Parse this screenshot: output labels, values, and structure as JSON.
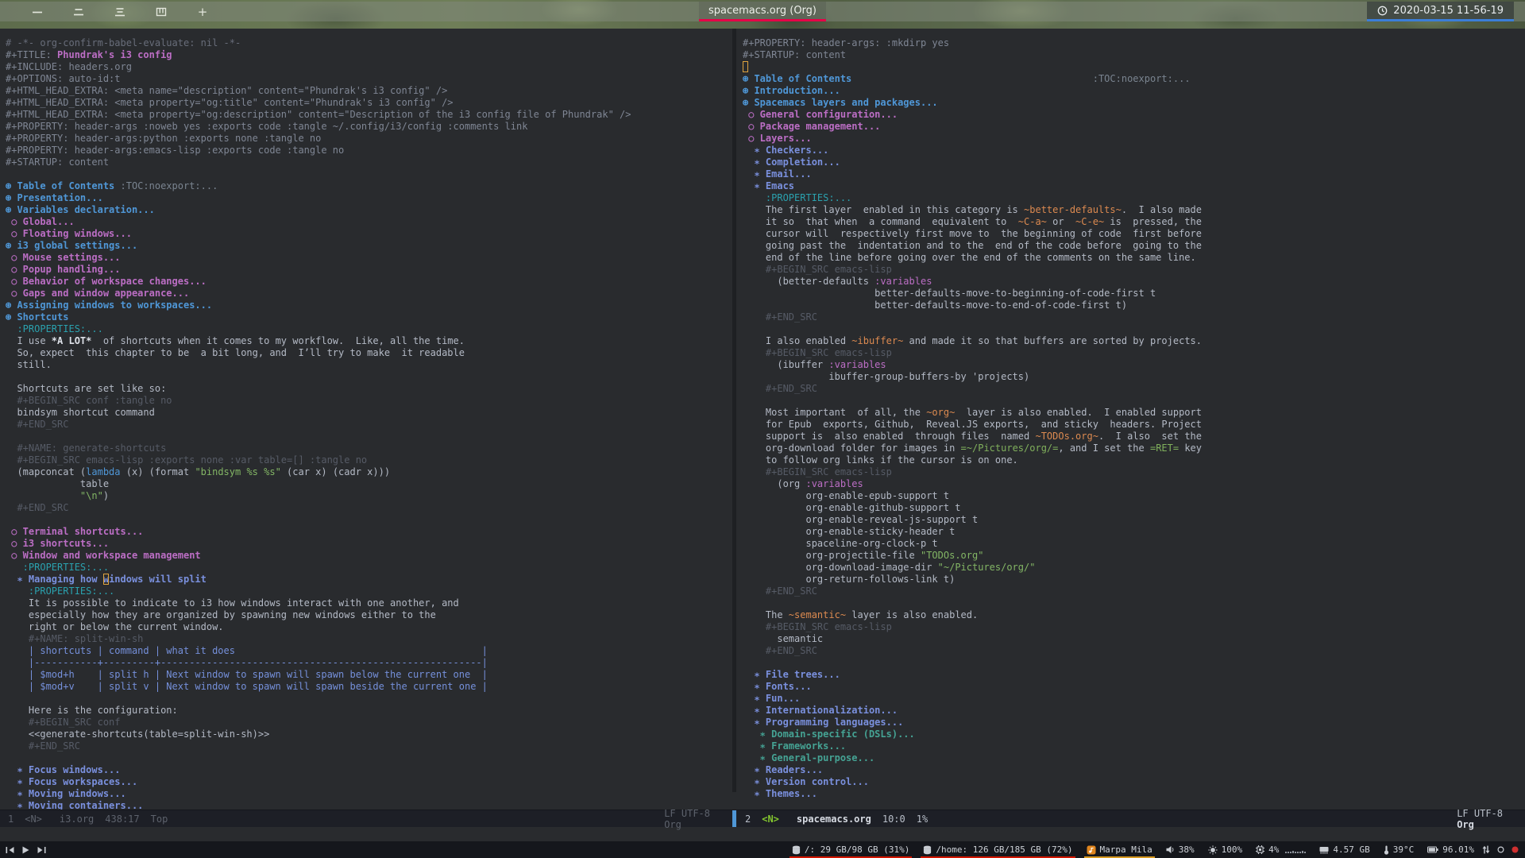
{
  "topbar": {
    "workspaces": [
      {
        "label": "一"
      },
      {
        "label": "二"
      },
      {
        "label": "三"
      },
      {
        "label": "四"
      },
      {
        "label": "+"
      }
    ],
    "window_title": "spacemacs.org (Org)",
    "title_underline_color": "#e60047",
    "clock": "2020-03-15 11-56-19",
    "clock_underline_color": "#3b7ed8"
  },
  "editor": {
    "left_modeline": {
      "win": "1",
      "state": "<N>",
      "buffer": "i3.org",
      "position": "438:17",
      "scroll": "Top",
      "eol_encoding": "LF UTF-8",
      "mode": "Org"
    },
    "right_modeline": {
      "win": "2",
      "state": "<N>",
      "buffer": "spacemacs.org",
      "position": "10:0",
      "scroll": "1%",
      "eol_encoding": "LF UTF-8",
      "mode": "Org"
    },
    "left_lines": [
      [
        [
          "cm",
          "# -*- org-confirm-babel-evaluate: nil -*-"
        ]
      ],
      [
        [
          "meta",
          "#+TITLE: "
        ],
        [
          "title",
          "Phundrak's i3 config"
        ]
      ],
      [
        [
          "meta",
          "#+INCLUDE: headers.org"
        ]
      ],
      [
        [
          "meta",
          "#+OPTIONS: auto-id:t"
        ]
      ],
      [
        [
          "meta",
          "#+HTML_HEAD_EXTRA: <meta name=\"description\" content=\"Phundrak's i3 config\" />"
        ]
      ],
      [
        [
          "meta",
          "#+HTML_HEAD_EXTRA: <meta property=\"og:title\" content=\"Phundrak's i3 config\" />"
        ]
      ],
      [
        [
          "meta",
          "#+HTML_HEAD_EXTRA: <meta property=\"og:description\" content=\"Description of the i3 config file of Phundrak\" />"
        ]
      ],
      [
        [
          "meta",
          "#+PROPERTY: header-args :noweb yes :exports code :tangle ~/.config/i3/config :comments link"
        ]
      ],
      [
        [
          "meta",
          "#+PROPERTY: header-args:python :exports none :tangle no"
        ]
      ],
      [
        [
          "meta",
          "#+PROPERTY: header-args:emacs-lisp :exports code :tangle no"
        ]
      ],
      [
        [
          "meta",
          "#+STARTUP: content"
        ]
      ],
      [],
      [
        [
          "h1",
          "⊛ Table of Contents"
        ],
        [
          "tag",
          " :TOC:noexport:..."
        ]
      ],
      [
        [
          "h1",
          "⊛ Presentation..."
        ]
      ],
      [
        [
          "h1",
          "⊛ Variables declaration..."
        ]
      ],
      [
        [
          "h2",
          " ○ Global..."
        ]
      ],
      [
        [
          "h2",
          " ○ Floating windows..."
        ]
      ],
      [
        [
          "h1",
          "⊛ i3 global settings..."
        ]
      ],
      [
        [
          "h2",
          " ○ Mouse settings..."
        ]
      ],
      [
        [
          "h2",
          " ○ Popup handling..."
        ]
      ],
      [
        [
          "h2",
          " ○ Behavior of workspace changes..."
        ]
      ],
      [
        [
          "h2",
          " ○ Gaps and window appearance..."
        ]
      ],
      [
        [
          "h1",
          "⊛ Assigning windows to workspaces..."
        ]
      ],
      [
        [
          "h1",
          "⊛ Shortcuts"
        ]
      ],
      [
        [
          "drw",
          "  :PROPERTIES:..."
        ]
      ],
      [
        [
          "b",
          "  I use "
        ],
        [
          "bold",
          "*A LOT*"
        ],
        [
          "b",
          "  of shortcuts when it comes to my workflow.  Like, all the time."
        ]
      ],
      [
        [
          "b",
          "  So, expect  this chapter to be  a bit long, and  I’ll try to make  it readable"
        ]
      ],
      [
        [
          "b",
          "  still."
        ]
      ],
      [],
      [
        [
          "b",
          "  Shortcuts are set like so:"
        ]
      ],
      [
        [
          "src",
          "  #+BEGIN_SRC conf :tangle no"
        ]
      ],
      [
        [
          "b",
          "  bindsym shortcut command"
        ]
      ],
      [
        [
          "src",
          "  #+END_SRC"
        ]
      ],
      [],
      [
        [
          "src",
          "  #+NAME: generate-shortcuts"
        ]
      ],
      [
        [
          "src",
          "  #+BEGIN_SRC emacs-lisp :exports none :var table=[] :tangle no"
        ]
      ],
      [
        [
          "b",
          "  (mapconcat ("
        ],
        [
          "kw",
          "lambda"
        ],
        [
          "b",
          " (x) (format "
        ],
        [
          "str",
          "\"bindsym %s %s\""
        ],
        [
          "b",
          " (car x) (cadr x)))"
        ]
      ],
      [
        [
          "b",
          "             table"
        ]
      ],
      [
        [
          "b",
          "             "
        ],
        [
          "str",
          "\"\\n\""
        ],
        [
          "b",
          ")"
        ]
      ],
      [
        [
          "src",
          "  #+END_SRC"
        ]
      ],
      [],
      [
        [
          "h2",
          " ○ Terminal shortcuts..."
        ]
      ],
      [
        [
          "h2",
          " ○ i3 shortcuts..."
        ]
      ],
      [
        [
          "h2",
          " ○ Window and workspace management"
        ]
      ],
      [
        [
          "drw",
          "   :PROPERTIES:..."
        ]
      ],
      [
        [
          "h3",
          "  ∗ Managing how "
        ],
        [
          "h3 cur",
          "w"
        ],
        [
          "h3",
          "indows will split"
        ]
      ],
      [
        [
          "drw",
          "    :PROPERTIES:..."
        ]
      ],
      [
        [
          "b",
          "    It is possible to indicate to i3 how windows interact with one another, and"
        ]
      ],
      [
        [
          "b",
          "    especially how they are organized by spawning new windows either to the"
        ]
      ],
      [
        [
          "b",
          "    right or below the current window."
        ]
      ],
      [
        [
          "src",
          "    #+NAME: split-win-sh"
        ]
      ],
      [
        [
          "tbl",
          "    | shortcuts | command | what it does                                           |"
        ]
      ],
      [
        [
          "tbl",
          "    |-----------+---------+--------------------------------------------------------|"
        ]
      ],
      [
        [
          "tbl",
          "    | $mod+h    | split h | Next window to spawn will spawn below the current one  |"
        ]
      ],
      [
        [
          "tbl",
          "    | $mod+v    | split v | Next window to spawn will spawn beside the current one |"
        ]
      ],
      [],
      [
        [
          "b",
          "    Here is the configuration:"
        ]
      ],
      [
        [
          "src",
          "    #+BEGIN_SRC conf"
        ]
      ],
      [
        [
          "b",
          "    <<generate-shortcuts(table=split-win-sh)>>"
        ]
      ],
      [
        [
          "src",
          "    #+END_SRC"
        ]
      ],
      [],
      [
        [
          "h3",
          "  ∗ Focus windows..."
        ]
      ],
      [
        [
          "h3",
          "  ∗ Focus workspaces..."
        ]
      ],
      [
        [
          "h3",
          "  ∗ Moving windows..."
        ]
      ],
      [
        [
          "h3",
          "  ∗ Moving containers..."
        ]
      ]
    ],
    "right_lines": [
      [
        [
          "meta",
          "#+PROPERTY: header-args: :mkdirp yes"
        ]
      ],
      [
        [
          "meta",
          "#+STARTUP: content"
        ]
      ],
      [
        [
          "cur",
          " "
        ]
      ],
      [
        [
          "h1",
          "⊛ Table of Contents"
        ],
        [
          "b",
          "                                          "
        ],
        [
          "tag",
          ":TOC:noexport:..."
        ]
      ],
      [
        [
          "h1",
          "⊛ Introduction..."
        ]
      ],
      [
        [
          "h1",
          "⊛ Spacemacs layers and packages..."
        ]
      ],
      [
        [
          "h2",
          " ○ General configuration..."
        ]
      ],
      [
        [
          "h2",
          " ○ Package management..."
        ]
      ],
      [
        [
          "h2",
          " ○ Layers..."
        ]
      ],
      [
        [
          "h3",
          "  ∗ Checkers..."
        ]
      ],
      [
        [
          "h3",
          "  ∗ Completion..."
        ]
      ],
      [
        [
          "h3",
          "  ∗ Email..."
        ]
      ],
      [
        [
          "h3",
          "  ∗ Emacs"
        ]
      ],
      [
        [
          "drw",
          "    :PROPERTIES:..."
        ]
      ],
      [
        [
          "b",
          "    The first layer  enabled in this category is "
        ],
        [
          "code",
          "~better-defaults~"
        ],
        [
          "b",
          ".  I also made"
        ]
      ],
      [
        [
          "b",
          "    it so  that when  a command  equivalent to  "
        ],
        [
          "code",
          "~C-a~"
        ],
        [
          "b",
          " or  "
        ],
        [
          "code",
          "~C-e~"
        ],
        [
          "b",
          " is  pressed, the"
        ]
      ],
      [
        [
          "b",
          "    cursor will  respectively first move to  the beginning of code  first before"
        ]
      ],
      [
        [
          "b",
          "    going past the  indentation and to the  end of the code before  going to the"
        ]
      ],
      [
        [
          "b",
          "    end of the line before going over the end of the comments on the same line."
        ]
      ],
      [
        [
          "src",
          "    #+BEGIN_SRC emacs-lisp"
        ]
      ],
      [
        [
          "b",
          "      (better-defaults "
        ],
        [
          "kwm",
          ":variables"
        ]
      ],
      [
        [
          "b",
          "                       better-defaults-move-to-beginning-of-code-first t"
        ]
      ],
      [
        [
          "b",
          "                       better-defaults-move-to-end-of-code-first t)"
        ]
      ],
      [
        [
          "src",
          "    #+END_SRC"
        ]
      ],
      [],
      [
        [
          "b",
          "    I also enabled "
        ],
        [
          "code",
          "~ibuffer~"
        ],
        [
          "b",
          " and made it so that buffers are sorted by projects."
        ]
      ],
      [
        [
          "src",
          "    #+BEGIN_SRC emacs-lisp"
        ]
      ],
      [
        [
          "b",
          "      (ibuffer "
        ],
        [
          "kwm",
          ":variables"
        ]
      ],
      [
        [
          "b",
          "               ibuffer-group-buffers-by 'projects)"
        ]
      ],
      [
        [
          "src",
          "    #+END_SRC"
        ]
      ],
      [],
      [
        [
          "b",
          "    Most important  of all, the "
        ],
        [
          "code",
          "~org~"
        ],
        [
          "b",
          "  layer is also enabled.  I enabled support"
        ]
      ],
      [
        [
          "b",
          "    for Epub  exports, Github,  Reveal.JS exports,  and sticky  headers. Project"
        ]
      ],
      [
        [
          "b",
          "    support is  also enabled  through files  named "
        ],
        [
          "code",
          "~TODOs.org~"
        ],
        [
          "b",
          ".  I also  set the"
        ]
      ],
      [
        [
          "b",
          "    org-download folder for images in "
        ],
        [
          "verb",
          "=~/Pictures/org/="
        ],
        [
          "b",
          ", and I set the "
        ],
        [
          "verb",
          "=RET="
        ],
        [
          "b",
          " key"
        ]
      ],
      [
        [
          "b",
          "    to follow org links if the cursor is on one."
        ]
      ],
      [
        [
          "src",
          "    #+BEGIN_SRC emacs-lisp"
        ]
      ],
      [
        [
          "b",
          "      (org "
        ],
        [
          "kwm",
          ":variables"
        ]
      ],
      [
        [
          "b",
          "           org-enable-epub-support t"
        ]
      ],
      [
        [
          "b",
          "           org-enable-github-support t"
        ]
      ],
      [
        [
          "b",
          "           org-enable-reveal-js-support t"
        ]
      ],
      [
        [
          "b",
          "           org-enable-sticky-header t"
        ]
      ],
      [
        [
          "b",
          "           spaceline-org-clock-p t"
        ]
      ],
      [
        [
          "b",
          "           org-projectile-file "
        ],
        [
          "str",
          "\"TODOs.org\""
        ]
      ],
      [
        [
          "b",
          "           org-download-image-dir "
        ],
        [
          "str",
          "\"~/Pictures/org/\""
        ]
      ],
      [
        [
          "b",
          "           org-return-follows-link t)"
        ]
      ],
      [
        [
          "src",
          "    #+END_SRC"
        ]
      ],
      [],
      [
        [
          "b",
          "    The "
        ],
        [
          "code",
          "~semantic~"
        ],
        [
          "b",
          " layer is also enabled."
        ]
      ],
      [
        [
          "src",
          "    #+BEGIN_SRC emacs-lisp"
        ]
      ],
      [
        [
          "b",
          "      semantic"
        ]
      ],
      [
        [
          "src",
          "    #+END_SRC"
        ]
      ],
      [],
      [
        [
          "h3",
          "  ∗ File trees..."
        ]
      ],
      [
        [
          "h3",
          "  ∗ Fonts..."
        ]
      ],
      [
        [
          "h3",
          "  ∗ Fun..."
        ]
      ],
      [
        [
          "h3",
          "  ∗ Internationalization..."
        ]
      ],
      [
        [
          "h3",
          "  ∗ Programming languages..."
        ]
      ],
      [
        [
          "h4",
          "   ∗ Domain-specific (DSLs)..."
        ]
      ],
      [
        [
          "h4",
          "   ∗ Frameworks..."
        ]
      ],
      [
        [
          "h4",
          "   ∗ General-purpose..."
        ]
      ],
      [
        [
          "h3",
          "  ∗ Readers..."
        ]
      ],
      [
        [
          "h3",
          "  ∗ Version control..."
        ]
      ],
      [
        [
          "h3",
          "  ∗ Themes..."
        ]
      ]
    ]
  },
  "bottombar": {
    "media_controls": [
      {
        "name": "previous-track-icon"
      },
      {
        "name": "play-icon"
      },
      {
        "name": "next-track-icon"
      }
    ],
    "segments": [
      {
        "name": "disk-root-block",
        "icon": "disk-icon",
        "text": "/: 29 GB/98 GB (31%)",
        "underline": "#d11500"
      },
      {
        "name": "disk-home-block",
        "icon": "disk-icon",
        "text": "/home: 126 GB/185 GB (72%)",
        "underline": "#d11500"
      },
      {
        "name": "now-playing-block",
        "icon": "music-icon",
        "text": "Marpa Mila",
        "underline": "#d79921"
      },
      {
        "name": "volume-block",
        "icon": "volume-icon",
        "text": "38%"
      },
      {
        "name": "brightness-block",
        "icon": "brightness-icon",
        "text": "100%"
      },
      {
        "name": "cpu-block",
        "icon": "cpu-icon",
        "text": "4%",
        "sparkline": [
          2,
          2,
          2,
          3,
          2,
          2,
          2,
          3,
          2
        ]
      },
      {
        "name": "memory-block",
        "icon": "memory-icon",
        "text": "4.57 GB"
      },
      {
        "name": "temperature-block",
        "icon": "temperature-icon",
        "text": "39°C"
      },
      {
        "name": "battery-block",
        "icon": "battery-icon",
        "text": "96.01%"
      }
    ],
    "tray": [
      {
        "name": "network-arrows-icon",
        "icon": "updown-arrows-icon"
      },
      {
        "name": "status-dot-icon",
        "icon": "dot-icon"
      },
      {
        "name": "recording-icon",
        "icon": "red-dot-icon"
      }
    ]
  }
}
